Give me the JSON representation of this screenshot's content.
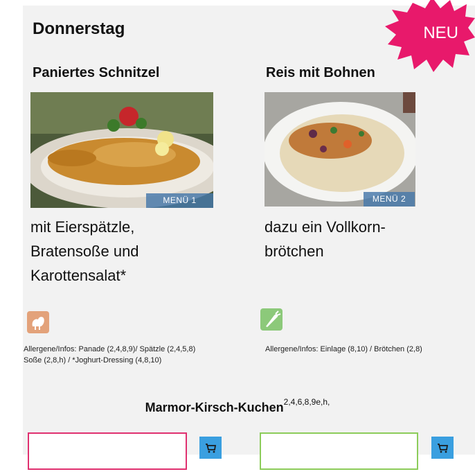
{
  "day": "Donnerstag",
  "badge": {
    "label": "NEU",
    "color": "#e8196b"
  },
  "menus": [
    {
      "name": "Paniertes Schnitzel",
      "tag": "MENÜ 1",
      "description": "mit Eierspätzle, Bratensoße und Karottensalat*",
      "icon": "chicken-icon",
      "icon_color": "#e3a27a",
      "allergens_line1": "Allergene/Infos: Panade (2,4,8,9)/ Spätzle (2,4,5,8)",
      "allergens_line2": "Soße (2,8,h) / *Joghurt-Dressing (4,8,10)",
      "input_border": "#e0306f"
    },
    {
      "name": "Reis mit Bohnen",
      "tag": "MENÜ 2",
      "description": "dazu ein Vollkorn-brötchen",
      "icon": "vegetable-icon",
      "icon_color": "#8cc97a",
      "allergens_line1": "Allergene/Infos: Einlage (8,10) / Brötchen (2,8)",
      "allergens_line2": "",
      "input_border": "#8ccc5a"
    }
  ],
  "dessert": {
    "name": "Marmor-Kirsch-Kuchen",
    "allergens": "2,4,6,8,9e,h,"
  },
  "cart_color": "#3a9fe0"
}
